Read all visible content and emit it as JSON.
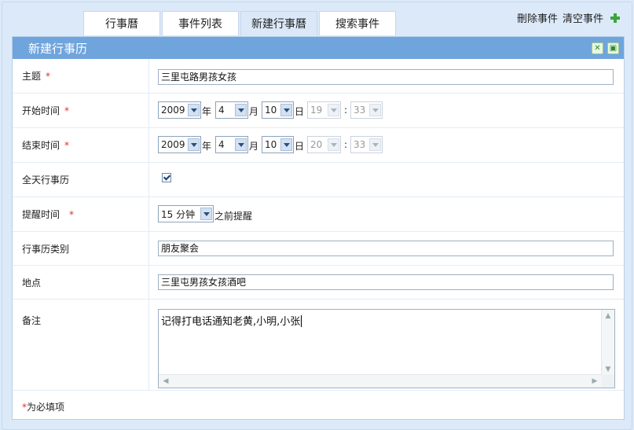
{
  "tabs": [
    "行事曆",
    "事件列表",
    "新建行事曆",
    "搜索事件"
  ],
  "actions": {
    "delete": "刪除事件",
    "clear": "清空事件"
  },
  "panel": {
    "title": "新建行事历"
  },
  "required_mark": "*",
  "fields": {
    "subject": {
      "label": "主题",
      "value": "三里屯路男孩女孩"
    },
    "start": {
      "label": "开始时间",
      "year": "2009",
      "month": "4",
      "day": "10",
      "hour": "19",
      "minute": "33"
    },
    "end": {
      "label": "结束时间",
      "year": "2009",
      "month": "4",
      "day": "10",
      "hour": "20",
      "minute": "33"
    },
    "allday": {
      "label": "全天行事历",
      "checked": true
    },
    "reminder": {
      "label": "提醒时间",
      "value": "15 分钟",
      "suffix": "之前提醒"
    },
    "category": {
      "label": "行事历类别",
      "value": "朋友聚会"
    },
    "location": {
      "label": "地点",
      "value": "三里屯男孩女孩酒吧"
    },
    "notes": {
      "label": "备注",
      "value": "记得打电话通知老黄,小明,小张"
    }
  },
  "units": {
    "year": "年",
    "month": "月",
    "day": "日",
    "colon": ":"
  },
  "footnote": {
    "star": "*",
    "text": "为必填项"
  },
  "colors": {
    "header": "#6fa4dd",
    "required": "#e0312b",
    "active_tab": "#dbe8f7"
  },
  "icons": [
    "plus-icon",
    "close-icon",
    "save-icon",
    "checkbox-checked"
  ]
}
